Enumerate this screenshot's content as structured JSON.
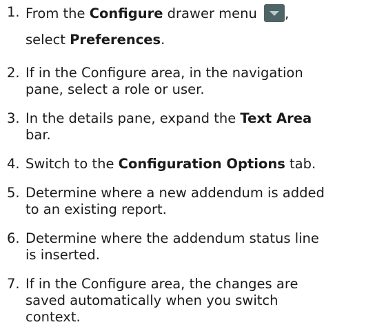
{
  "steps": [
    {
      "number": "1.",
      "text": {
        "a": "From the ",
        "b": "Configure",
        "c": " drawer menu ",
        "d": ",",
        "e": "select ",
        "f": "Preferences",
        "g": "."
      },
      "icon": "drawer-menu-dropdown-icon"
    },
    {
      "number": "2.",
      "lines": [
        "If in the Configure area, in the navigation",
        "pane, select a role or user."
      ]
    },
    {
      "number": "3.",
      "text": {
        "a": "In the details pane, expand the ",
        "b": "Text Area",
        "c": "bar."
      }
    },
    {
      "number": "4.",
      "text": {
        "a": "Switch to the ",
        "b": "Configuration Options",
        "c": " tab."
      }
    },
    {
      "number": "5.",
      "lines": [
        "Determine where a new addendum is added",
        "to an existing report."
      ]
    },
    {
      "number": "6.",
      "lines": [
        "Determine where the addendum status line",
        "is inserted."
      ]
    },
    {
      "number": "7.",
      "lines": [
        "If in the Configure area, the changes are",
        "saved automatically when you switch",
        "context."
      ]
    }
  ]
}
